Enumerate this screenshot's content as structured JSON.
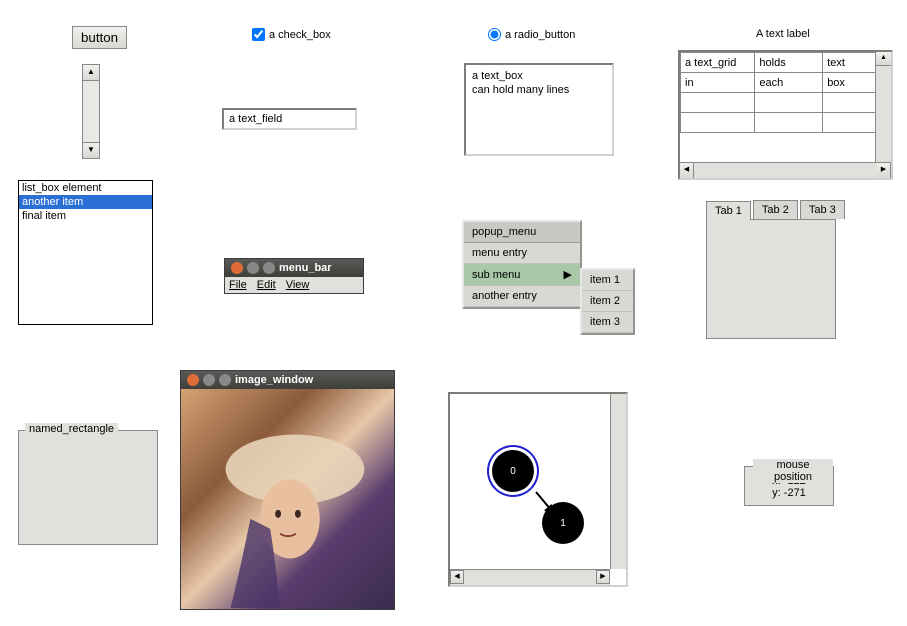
{
  "button_label": "button",
  "checkbox_label": "a check_box",
  "radio_label": "a radio_button",
  "text_label": "A text label",
  "text_field_value": "a text_field",
  "text_box_value": "a text_box\ncan hold many lines",
  "text_grid": {
    "rows": [
      [
        "a text_grid",
        "holds",
        "text"
      ],
      [
        "in",
        "each",
        "box"
      ],
      [
        "",
        "",
        ""
      ],
      [
        "",
        "",
        ""
      ]
    ]
  },
  "list_box": {
    "items": [
      "list_box element",
      "another item",
      "final item"
    ],
    "selected_index": 1
  },
  "menu_window": {
    "title": "menu_bar",
    "items": [
      "File",
      "Edit",
      "View"
    ]
  },
  "popup": {
    "header": "popup_menu",
    "items": [
      "menu entry",
      "sub menu",
      "another entry"
    ],
    "highlighted_index": 1,
    "submenu_items": [
      "item 1",
      "item 2",
      "item 3"
    ]
  },
  "tabs": {
    "labels": [
      "Tab 1",
      "Tab 2",
      "Tab 3"
    ],
    "active_index": 0
  },
  "named_rectangle_label": "named_rectangle",
  "image_window_title": "image_window",
  "graph": {
    "nodes": [
      {
        "id": "0",
        "selected": true
      },
      {
        "id": "1",
        "selected": false
      }
    ]
  },
  "mouse_position": {
    "legend": "mouse position",
    "x_label": "x: -122",
    "y_label": "y: -271"
  }
}
